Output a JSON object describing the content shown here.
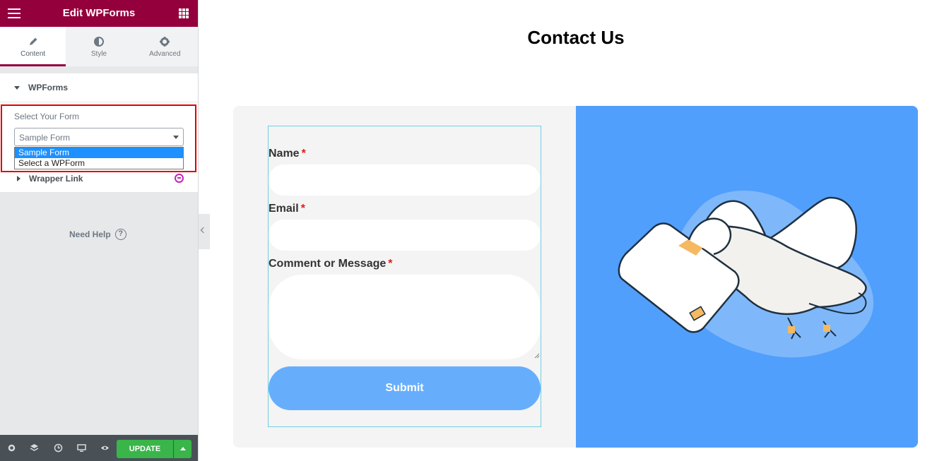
{
  "sidebar": {
    "header_title": "Edit WPForms",
    "tabs": [
      {
        "label": "Content",
        "icon": "pencil-icon",
        "active": true
      },
      {
        "label": "Style",
        "icon": "half-circle-icon",
        "active": false
      },
      {
        "label": "Advanced",
        "icon": "gear-icon",
        "active": false
      }
    ],
    "section_title": "WPForms",
    "select_label": "Select Your Form",
    "select_value": "Sample Form",
    "dropdown_options": [
      "Sample Form",
      "Select a WPForm"
    ],
    "wrapper_link_label": "Wrapper Link",
    "need_help": "Need Help",
    "need_help_icon": "?",
    "update_label": "UPDATE"
  },
  "page": {
    "title": "Contact Us",
    "form": {
      "name_label": "Name",
      "email_label": "Email",
      "message_label": "Comment or Message",
      "required_mark": "*",
      "submit_label": "Submit"
    }
  },
  "colors": {
    "header": "#93003c",
    "update_button": "#39b54a",
    "panel_blue": "#519ffc",
    "submit_button": "#66aefc",
    "highlight": "#e00000",
    "required": "#e21b1b"
  }
}
